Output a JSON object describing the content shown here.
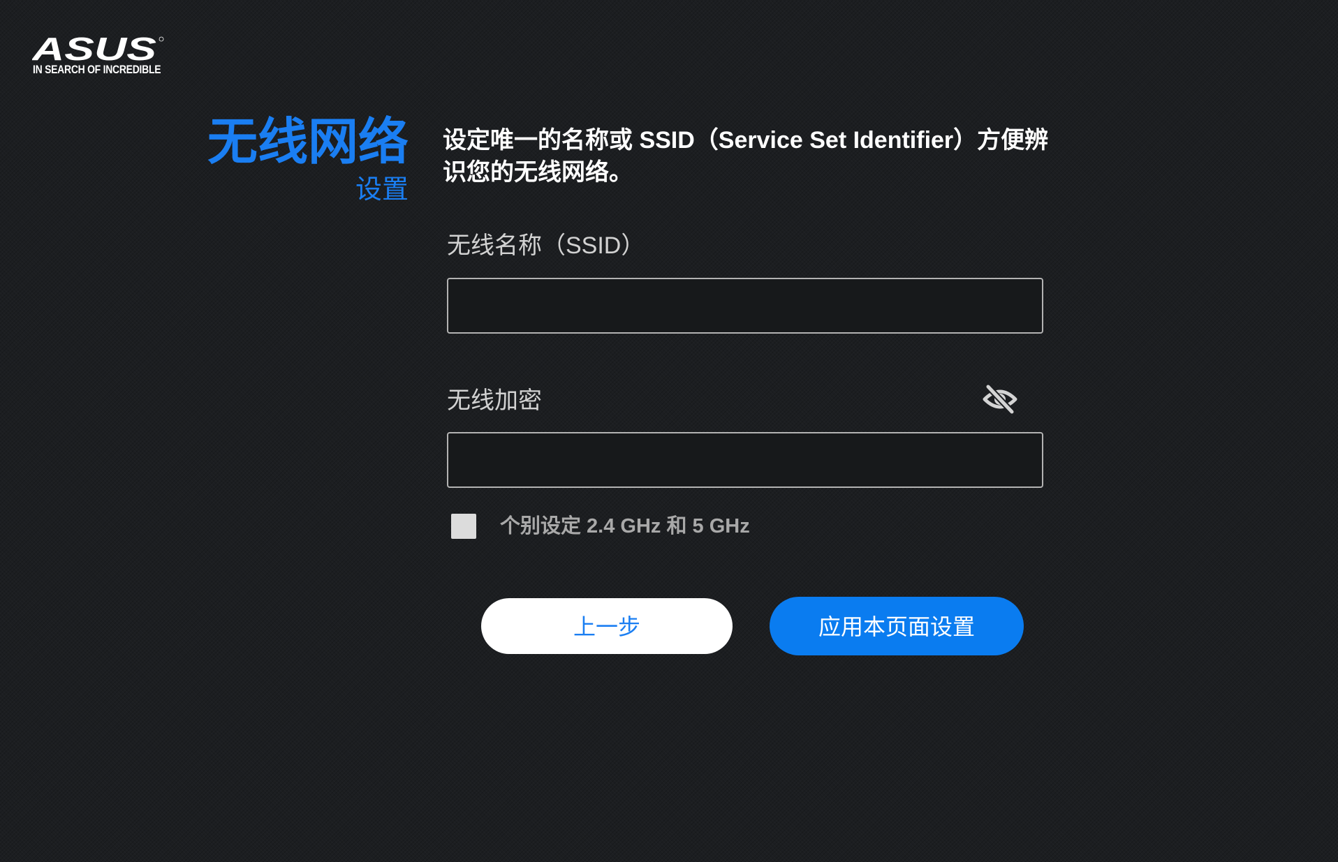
{
  "brand": {
    "logo_text": "ASUS",
    "tagline": "IN SEARCH OF INCREDIBLE"
  },
  "header": {
    "title": "无线网络",
    "subtitle": "设置",
    "description": "设定唯一的名称或 SSID（Service Set Identifier）方便辨识您的无线网络。"
  },
  "form": {
    "ssid_label": "无线名称（SSID）",
    "ssid_value": "",
    "password_label": "无线加密",
    "password_value": "",
    "password_visibility_icon": "eye-slash-icon",
    "separate_bands_label": "个别设定 2.4 GHz 和 5 GHz",
    "separate_bands_checked": false
  },
  "buttons": {
    "back_label": "上一步",
    "apply_label": "应用本页面设置"
  },
  "colors": {
    "accent": "#1a7ef2",
    "primary_button": "#0a7cf0",
    "background": "#1c1e21",
    "checkbox_fill": "#dcdcdc"
  }
}
